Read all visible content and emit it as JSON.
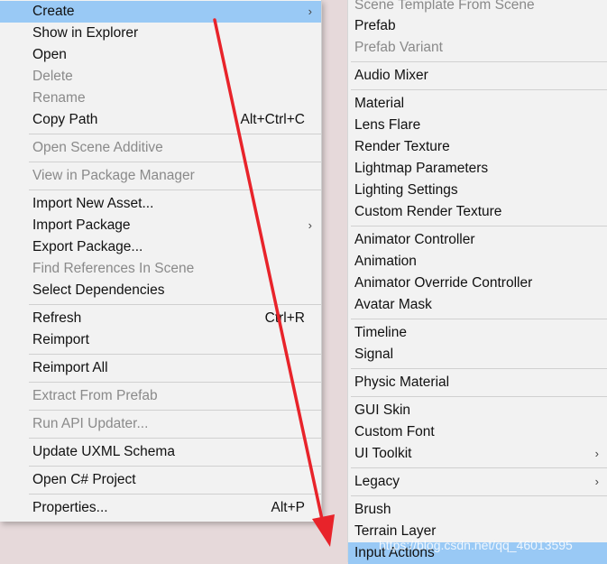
{
  "context_menu": {
    "items": [
      {
        "label": "Create",
        "shortcut": "",
        "submenu": true,
        "disabled": false,
        "highlighted": true
      },
      {
        "label": "Show in Explorer",
        "shortcut": "",
        "submenu": false,
        "disabled": false
      },
      {
        "label": "Open",
        "shortcut": "",
        "submenu": false,
        "disabled": false
      },
      {
        "label": "Delete",
        "shortcut": "",
        "submenu": false,
        "disabled": true
      },
      {
        "label": "Rename",
        "shortcut": "",
        "submenu": false,
        "disabled": true
      },
      {
        "label": "Copy Path",
        "shortcut": "Alt+Ctrl+C",
        "submenu": false,
        "disabled": false
      },
      {
        "label": "Open Scene Additive",
        "shortcut": "",
        "submenu": false,
        "disabled": true
      },
      {
        "label": "View in Package Manager",
        "shortcut": "",
        "submenu": false,
        "disabled": true
      },
      {
        "label": "Import New Asset...",
        "shortcut": "",
        "submenu": false,
        "disabled": false
      },
      {
        "label": "Import Package",
        "shortcut": "",
        "submenu": true,
        "disabled": false
      },
      {
        "label": "Export Package...",
        "shortcut": "",
        "submenu": false,
        "disabled": false
      },
      {
        "label": "Find References In Scene",
        "shortcut": "",
        "submenu": false,
        "disabled": true
      },
      {
        "label": "Select Dependencies",
        "shortcut": "",
        "submenu": false,
        "disabled": false
      },
      {
        "label": "Refresh",
        "shortcut": "Ctrl+R",
        "submenu": false,
        "disabled": false
      },
      {
        "label": "Reimport",
        "shortcut": "",
        "submenu": false,
        "disabled": false
      },
      {
        "label": "Reimport All",
        "shortcut": "",
        "submenu": false,
        "disabled": false
      },
      {
        "label": "Extract From Prefab",
        "shortcut": "",
        "submenu": false,
        "disabled": true
      },
      {
        "label": "Run API Updater...",
        "shortcut": "",
        "submenu": false,
        "disabled": true
      },
      {
        "label": "Update UXML Schema",
        "shortcut": "",
        "submenu": false,
        "disabled": false
      },
      {
        "label": "Open C# Project",
        "shortcut": "",
        "submenu": false,
        "disabled": false
      },
      {
        "label": "Properties...",
        "shortcut": "Alt+P",
        "submenu": false,
        "disabled": false
      }
    ]
  },
  "create_submenu": {
    "items": [
      {
        "label": "Scene Template From Scene",
        "submenu": false,
        "disabled": true
      },
      {
        "label": "Prefab",
        "submenu": false,
        "disabled": false
      },
      {
        "label": "Prefab Variant",
        "submenu": false,
        "disabled": true
      },
      {
        "label": "Audio Mixer",
        "submenu": false,
        "disabled": false
      },
      {
        "label": "Material",
        "submenu": false,
        "disabled": false
      },
      {
        "label": "Lens Flare",
        "submenu": false,
        "disabled": false
      },
      {
        "label": "Render Texture",
        "submenu": false,
        "disabled": false
      },
      {
        "label": "Lightmap Parameters",
        "submenu": false,
        "disabled": false
      },
      {
        "label": "Lighting Settings",
        "submenu": false,
        "disabled": false
      },
      {
        "label": "Custom Render Texture",
        "submenu": false,
        "disabled": false
      },
      {
        "label": "Animator Controller",
        "submenu": false,
        "disabled": false
      },
      {
        "label": "Animation",
        "submenu": false,
        "disabled": false
      },
      {
        "label": "Animator Override Controller",
        "submenu": false,
        "disabled": false
      },
      {
        "label": "Avatar Mask",
        "submenu": false,
        "disabled": false
      },
      {
        "label": "Timeline",
        "submenu": false,
        "disabled": false
      },
      {
        "label": "Signal",
        "submenu": false,
        "disabled": false
      },
      {
        "label": "Physic Material",
        "submenu": false,
        "disabled": false
      },
      {
        "label": "GUI Skin",
        "submenu": false,
        "disabled": false
      },
      {
        "label": "Custom Font",
        "submenu": false,
        "disabled": false
      },
      {
        "label": "UI Toolkit",
        "submenu": true,
        "disabled": false
      },
      {
        "label": "Legacy",
        "submenu": true,
        "disabled": false
      },
      {
        "label": "Brush",
        "submenu": false,
        "disabled": false
      },
      {
        "label": "Terrain Layer",
        "submenu": false,
        "disabled": false
      },
      {
        "label": "Input Actions",
        "submenu": false,
        "disabled": false,
        "highlighted": true
      }
    ]
  },
  "submenu_arrow_glyph": "›",
  "watermark": "https://blog.csdn.net/qq_46013595",
  "colors": {
    "highlight": "#99c9f5",
    "annotation_arrow": "#e8232a"
  }
}
